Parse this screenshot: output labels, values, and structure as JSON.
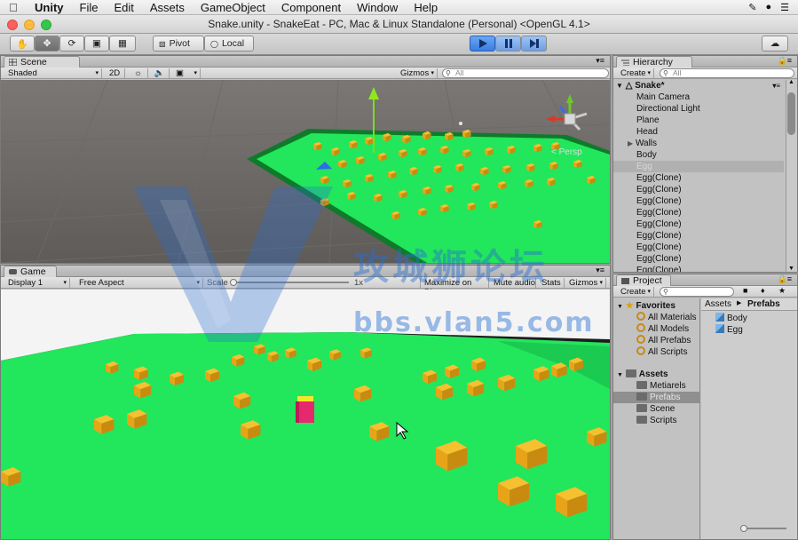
{
  "menubar": {
    "apple_icon": "apple-icon",
    "app_name": "Unity",
    "items": [
      "File",
      "Edit",
      "Assets",
      "GameObject",
      "Component",
      "Window",
      "Help"
    ]
  },
  "window": {
    "title": "Snake.unity - SnakeEat - PC, Mac & Linux Standalone (Personal) <OpenGL 4.1>"
  },
  "toolbar": {
    "pivot_label": "Pivot",
    "local_label": "Local"
  },
  "scene": {
    "tab_label": "Scene",
    "shading_mode": "Shaded",
    "mode_2d": "2D",
    "gizmos_label": "Gizmos",
    "search_placeholder": "All",
    "persp_label": "< Persp"
  },
  "game": {
    "tab_label": "Game",
    "display": "Display 1",
    "aspect": "Free Aspect",
    "scale_label": "Scale",
    "scale_value": "1x",
    "maximize_label": "Maximize on Play",
    "mute_label": "Mute audio",
    "stats_label": "Stats",
    "gizmos_label": "Gizmos"
  },
  "hierarchy": {
    "tab_label": "Hierarchy",
    "create_label": "Create",
    "search_placeholder": "All",
    "scene_name": "Snake*",
    "items": [
      "Main Camera",
      "Directional Light",
      "Plane",
      "Head",
      "Walls",
      "Body",
      "Egg",
      "Egg(Clone)",
      "Egg(Clone)",
      "Egg(Clone)",
      "Egg(Clone)",
      "Egg(Clone)",
      "Egg(Clone)",
      "Egg(Clone)",
      "Egg(Clone)",
      "Egg(Clone)"
    ],
    "selected": "Egg"
  },
  "project": {
    "tab_label": "Project",
    "create_label": "Create",
    "favorites_label": "Favorites",
    "favorites": [
      "All Materials",
      "All Models",
      "All Prefabs",
      "All Scripts"
    ],
    "assets_label": "Assets",
    "folders": [
      "Metiarels",
      "Prefabs",
      "Scene",
      "Scripts"
    ],
    "selected_folder": "Prefabs",
    "breadcrumb": [
      "Assets",
      "Prefabs"
    ],
    "files": [
      "Body",
      "Egg"
    ]
  },
  "watermark": {
    "cn_text": "攻城狮论坛",
    "url_text": "bbs.vlan5.com"
  },
  "colors": {
    "ground": "#22e65c",
    "egg": "#e8a418",
    "head": "#e6286e",
    "accent_blue": "#3a7de0"
  }
}
